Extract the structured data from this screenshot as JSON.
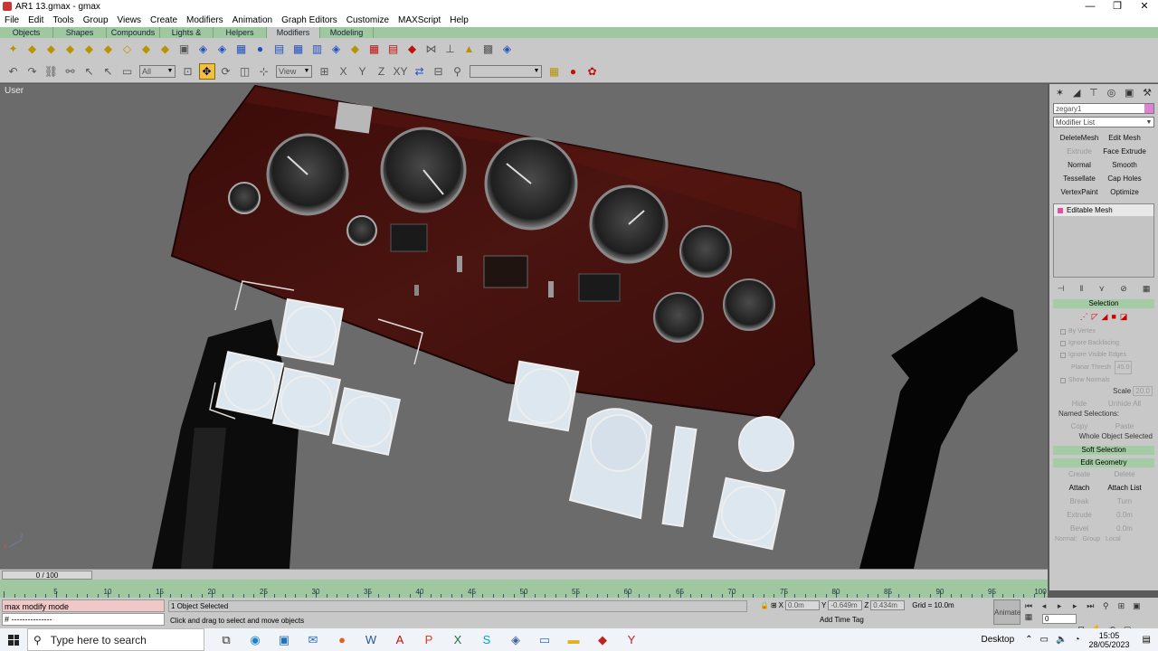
{
  "window": {
    "title": "AR1 13.gmax - gmax",
    "controls": [
      "—",
      "❐",
      "✕"
    ]
  },
  "menu": [
    "File",
    "Edit",
    "Tools",
    "Group",
    "Views",
    "Create",
    "Modifiers",
    "Animation",
    "Graph Editors",
    "Customize",
    "MAXScript",
    "Help"
  ],
  "tabs": [
    "Objects",
    "Shapes",
    "Compounds",
    "Lights & Cameras",
    "Helpers",
    "Modifiers",
    "Modeling"
  ],
  "active_tab": "Modifiers",
  "toolbar2": {
    "selection_filter": "All",
    "ref_coord": "View",
    "named_set": ""
  },
  "viewport": {
    "label": "User",
    "axis_x": "x",
    "axis_z": "z"
  },
  "command_panel": {
    "object_name": "zegary1",
    "modifier_list": "Modifier List",
    "modifier_buttons": [
      {
        "label": "DeleteMesh",
        "enabled": true
      },
      {
        "label": "Edit Mesh",
        "enabled": true
      },
      {
        "label": "Extrude",
        "enabled": false
      },
      {
        "label": "Face Extrude",
        "enabled": true
      },
      {
        "label": "Normal",
        "enabled": true
      },
      {
        "label": "Smooth",
        "enabled": true
      },
      {
        "label": "Tessellate",
        "enabled": true
      },
      {
        "label": "Cap Holes",
        "enabled": true
      },
      {
        "label": "VertexPaint",
        "enabled": true
      },
      {
        "label": "Optimize",
        "enabled": true
      }
    ],
    "stack_item": "Editable Mesh",
    "selection_rollout": "Selection",
    "options": [
      "By Vertex",
      "Ignore Backfacing",
      "Ignore Visible Edges"
    ],
    "planar_thresh_label": "Planar Thresh",
    "planar_thresh": "45.0",
    "show_normals": "Show Normals",
    "scale_label": "Scale",
    "scale": "20.0",
    "hide": "Hide",
    "unhide_all": "Unhide All",
    "named_selections": "Named Selections:",
    "copy": "Copy",
    "paste": "Paste",
    "whole_object": "Whole Object Selected",
    "soft_selection": "Soft Selection",
    "edit_geometry": "Edit Geometry",
    "create": "Create",
    "delete": "Delete",
    "attach": "Attach",
    "attach_list": "Attach List",
    "break": "Break",
    "turn": "Turn",
    "extrude": "Extrude",
    "extrude_val": "0.0m",
    "bevel": "Bevel",
    "bevel_val": "0.0m",
    "normal_label": "Normal:",
    "group": "Group",
    "local": "Local"
  },
  "timeline": {
    "position": "0 / 100",
    "ticks": [
      "0",
      "5",
      "10",
      "15",
      "20",
      "25",
      "30",
      "35",
      "40",
      "45",
      "50",
      "55",
      "60",
      "65",
      "70",
      "75",
      "80",
      "85",
      "90",
      "95",
      "100"
    ]
  },
  "status": {
    "maxscript_line1": "max modify mode",
    "maxscript_line2": "# ---------------",
    "selection": "1 Object Selected",
    "prompt": "Click and drag to select and move objects",
    "x_label": "X",
    "x": "0.0m",
    "y_label": "Y",
    "y": "-0.649m",
    "z_label": "Z",
    "z": "0.434m",
    "grid": "Grid = 10.0m",
    "add_time_tag": "Add Time Tag",
    "animate": "Animate",
    "frame": "0"
  },
  "taskbar": {
    "search_placeholder": "Type here to search",
    "desktop": "Desktop",
    "time": "15:05",
    "date": "28/05/2023"
  }
}
